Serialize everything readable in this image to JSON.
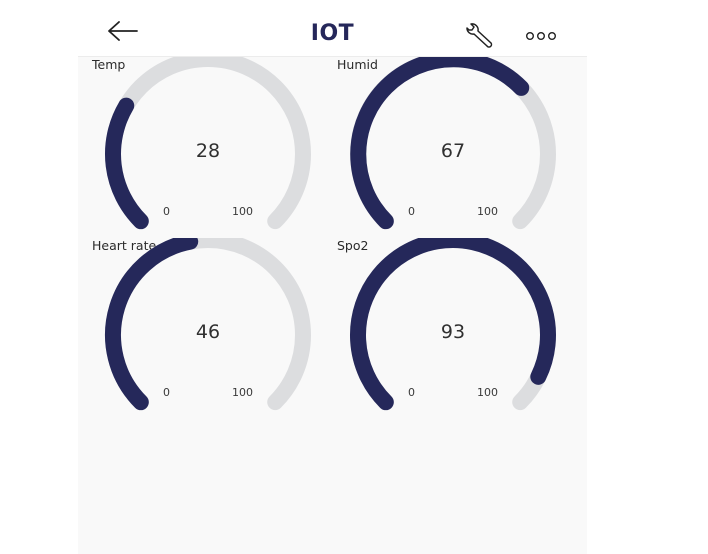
{
  "header": {
    "title": "IOT",
    "back_icon": "arrow-left-icon",
    "settings_icon": "wrench-icon",
    "menu_icon": "more-horizontal-icon"
  },
  "colors": {
    "accent": "#25285a",
    "track": "#dcdddf"
  },
  "gauges": [
    {
      "label": "Temp",
      "value": "28",
      "min": "0",
      "max": "100"
    },
    {
      "label": "Humid",
      "value": "67",
      "min": "0",
      "max": "100"
    },
    {
      "label": "Heart rate",
      "value": "46",
      "min": "0",
      "max": "100"
    },
    {
      "label": "Spo2",
      "value": "93",
      "min": "0",
      "max": "100"
    }
  ]
}
